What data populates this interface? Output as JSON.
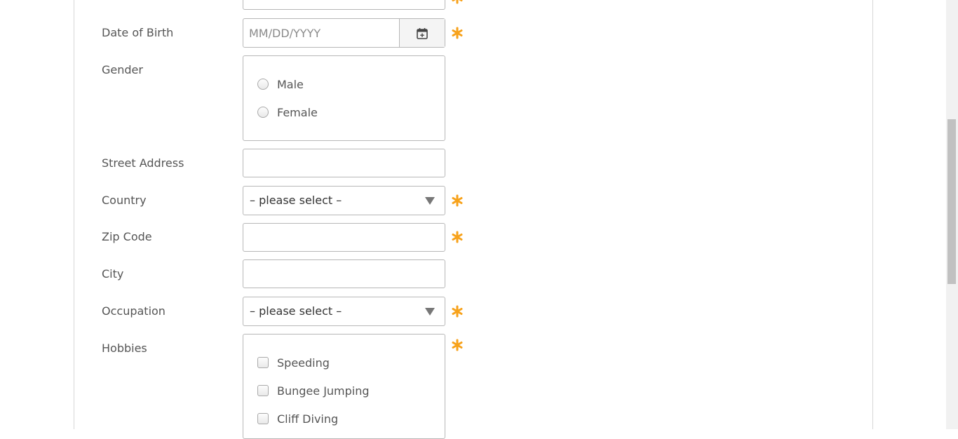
{
  "form": {
    "date_of_birth": {
      "label": "Date of Birth",
      "placeholder": "MM/DD/YYYY"
    },
    "gender": {
      "label": "Gender",
      "options": [
        "Male",
        "Female"
      ]
    },
    "street_address": {
      "label": "Street Address",
      "value": ""
    },
    "country": {
      "label": "Country",
      "selected": "– please select –"
    },
    "zip_code": {
      "label": "Zip Code",
      "value": ""
    },
    "city": {
      "label": "City",
      "value": ""
    },
    "occupation": {
      "label": "Occupation",
      "selected": "– please select –"
    },
    "hobbies": {
      "label": "Hobbies",
      "options": [
        "Speeding",
        "Bungee Jumping",
        "Cliff Diving"
      ]
    }
  },
  "icons": {
    "calendar": "calendar-icon",
    "required": "required-asterisk-icon",
    "dropdown": "chevron-down-icon"
  },
  "colors": {
    "required_star": "#f7a21b",
    "border": "#b7b7b7",
    "label_text": "#555555"
  }
}
